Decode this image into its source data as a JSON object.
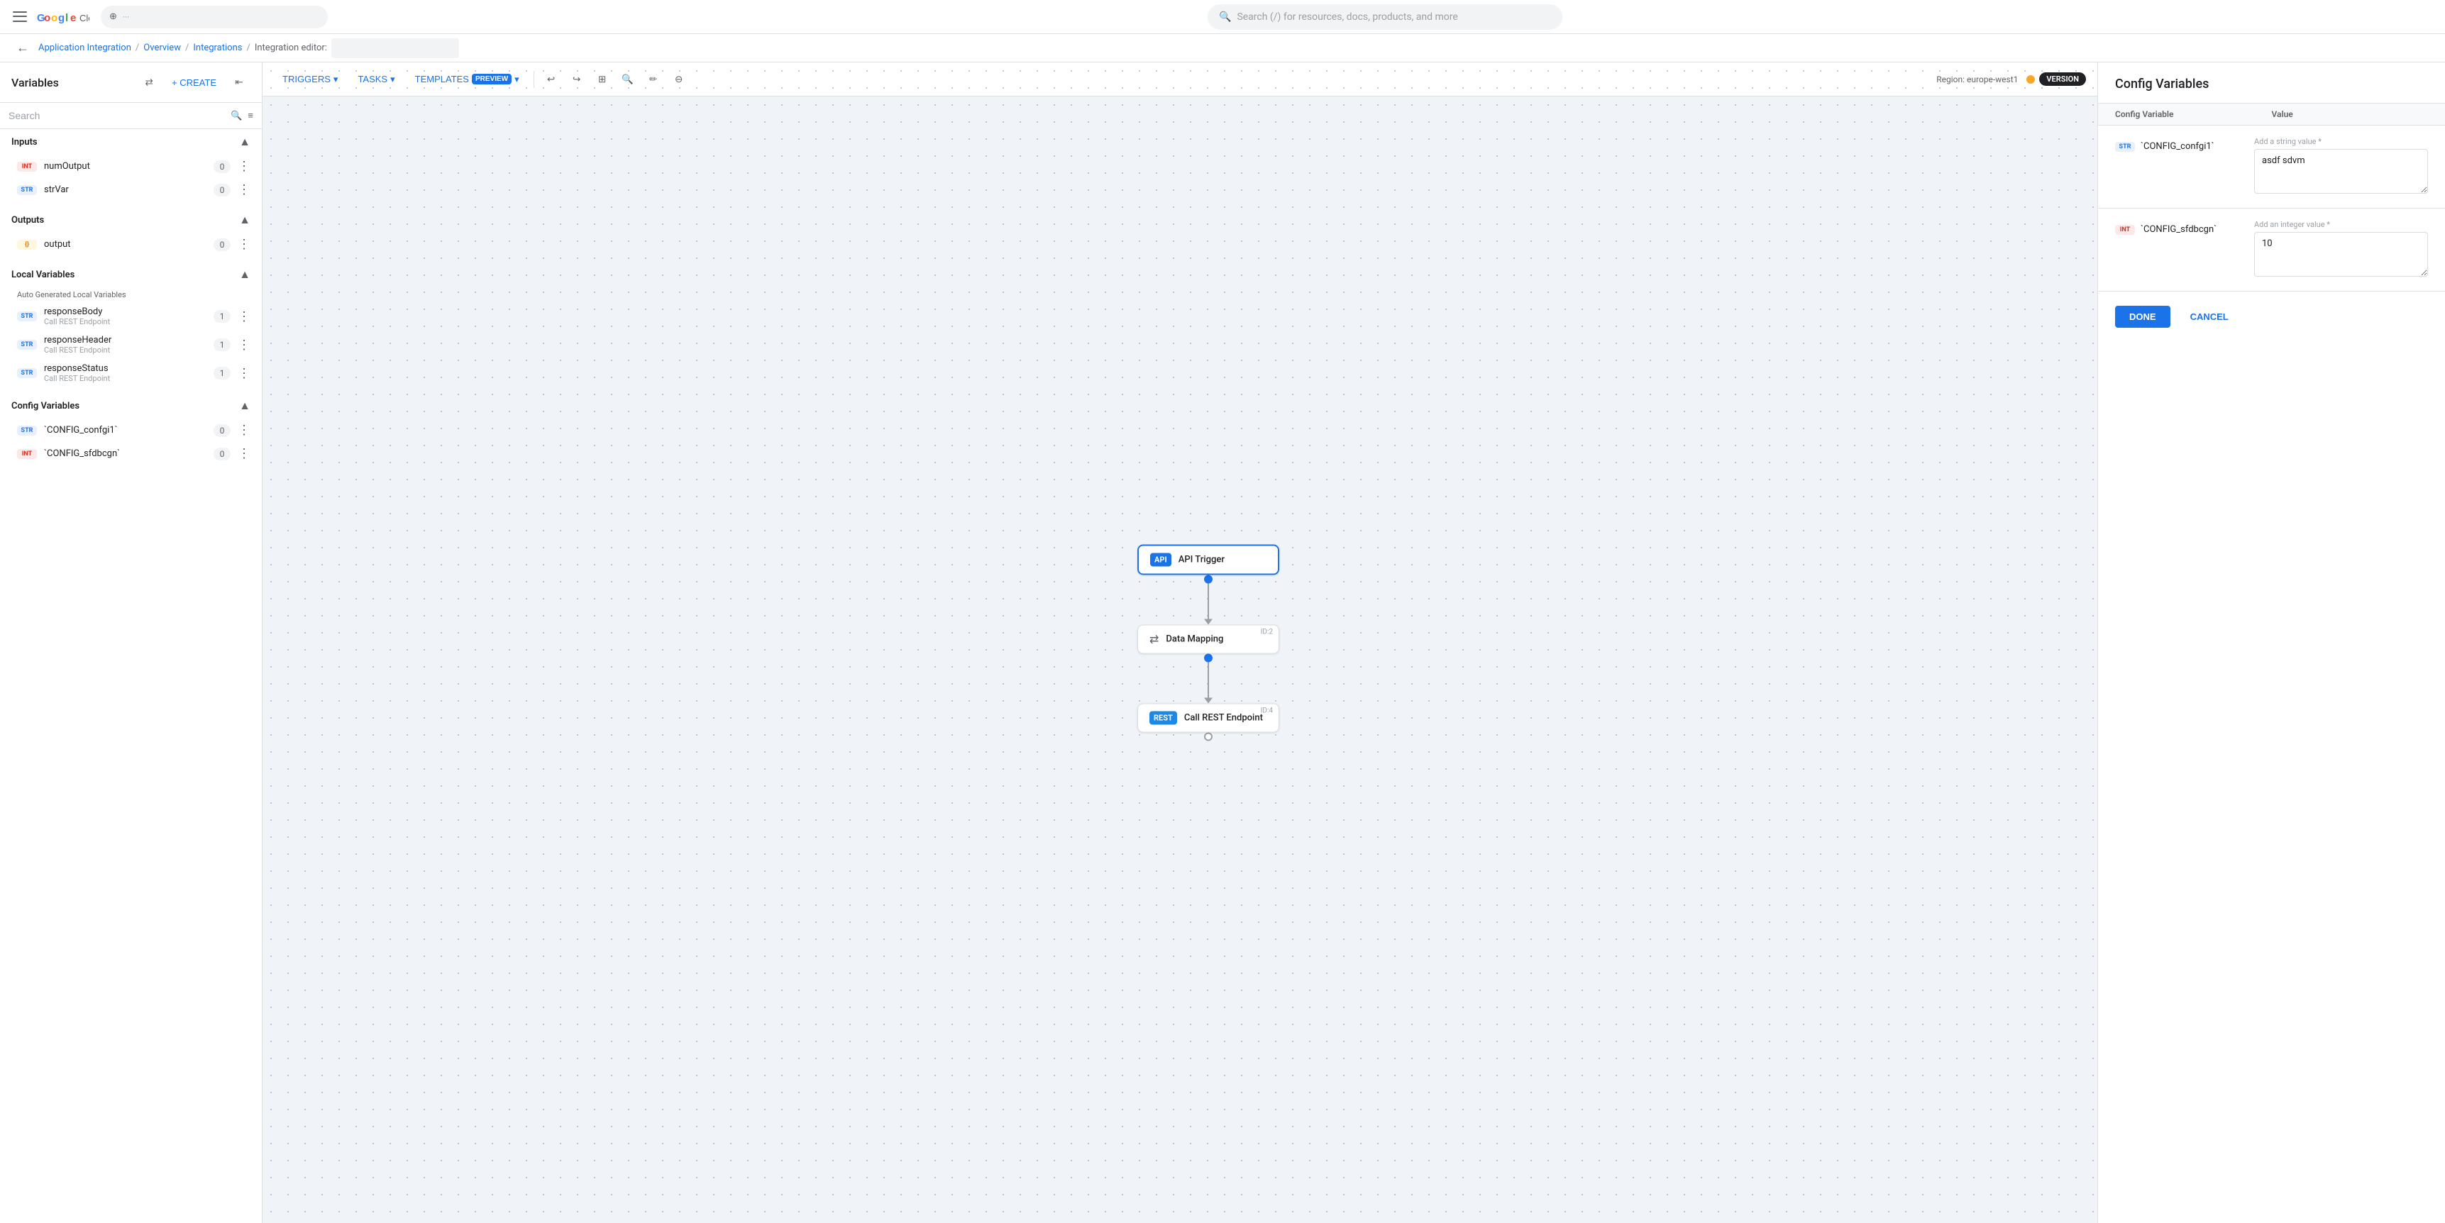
{
  "topbar": {
    "search_placeholder": "Search (/) for resources, docs, products, and more"
  },
  "breadcrumb": {
    "items": [
      "Application Integration",
      "Overview",
      "Integrations",
      "Integration editor:"
    ]
  },
  "variables_panel": {
    "title": "Variables",
    "create_label": "+ CREATE",
    "search_placeholder": "Search",
    "sections": {
      "inputs": {
        "title": "Inputs",
        "items": [
          {
            "type": "INT",
            "type_class": "int",
            "name": "numOutput",
            "count": "0"
          },
          {
            "type": "STR",
            "type_class": "str",
            "name": "strVar",
            "count": "0"
          }
        ]
      },
      "outputs": {
        "title": "Outputs",
        "items": [
          {
            "type": "{}}",
            "type_class": "json",
            "name": "output",
            "count": "0"
          }
        ]
      },
      "local_variables": {
        "title": "Local Variables",
        "auto_label": "Auto Generated Local Variables",
        "items": [
          {
            "type": "STR",
            "type_class": "str",
            "name": "responseBody",
            "sub": "Call REST Endpoint",
            "count": "1"
          },
          {
            "type": "STR",
            "type_class": "str",
            "name": "responseHeader",
            "sub": "Call REST Endpoint",
            "count": "1"
          },
          {
            "type": "STR",
            "type_class": "str",
            "name": "responseStatus",
            "sub": "Call REST Endpoint",
            "count": "1"
          }
        ]
      },
      "config_variables": {
        "title": "Config Variables",
        "items": [
          {
            "type": "STR",
            "type_class": "str",
            "name": "`CONFIG_confgi1`",
            "count": "0"
          },
          {
            "type": "INT",
            "type_class": "int",
            "name": "`CONFIG_sfdbcgn`",
            "count": "0"
          }
        ]
      }
    }
  },
  "toolbar": {
    "triggers_label": "TRIGGERS",
    "tasks_label": "TASKS",
    "templates_label": "TEMPLATES",
    "preview_label": "PREVIEW",
    "region_label": "Region: europe-west1",
    "version_label": "VERSION"
  },
  "flow": {
    "nodes": [
      {
        "id": null,
        "icon": "API",
        "icon_type": "api",
        "label": "API Trigger"
      },
      {
        "id": "ID:2",
        "icon": "⇄",
        "icon_type": "data",
        "label": "Data Mapping"
      },
      {
        "id": "ID:4",
        "icon": "REST",
        "icon_type": "rest",
        "label": "Call REST Endpoint"
      }
    ]
  },
  "config_panel": {
    "title": "Config Variables",
    "col_variable": "Config Variable",
    "col_value": "Value",
    "rows": [
      {
        "type_badge": "STR",
        "type_class": "str",
        "var_name": "`CONFIG_confgi1`",
        "placeholder": "Add a string value *",
        "value": "asdf sdvm"
      },
      {
        "type_badge": "INT",
        "type_class": "int",
        "var_name": "`CONFIG_sfdbcgn`",
        "placeholder": "Add an integer value *",
        "value": "10"
      }
    ],
    "done_label": "DONE",
    "cancel_label": "CANCEL"
  }
}
